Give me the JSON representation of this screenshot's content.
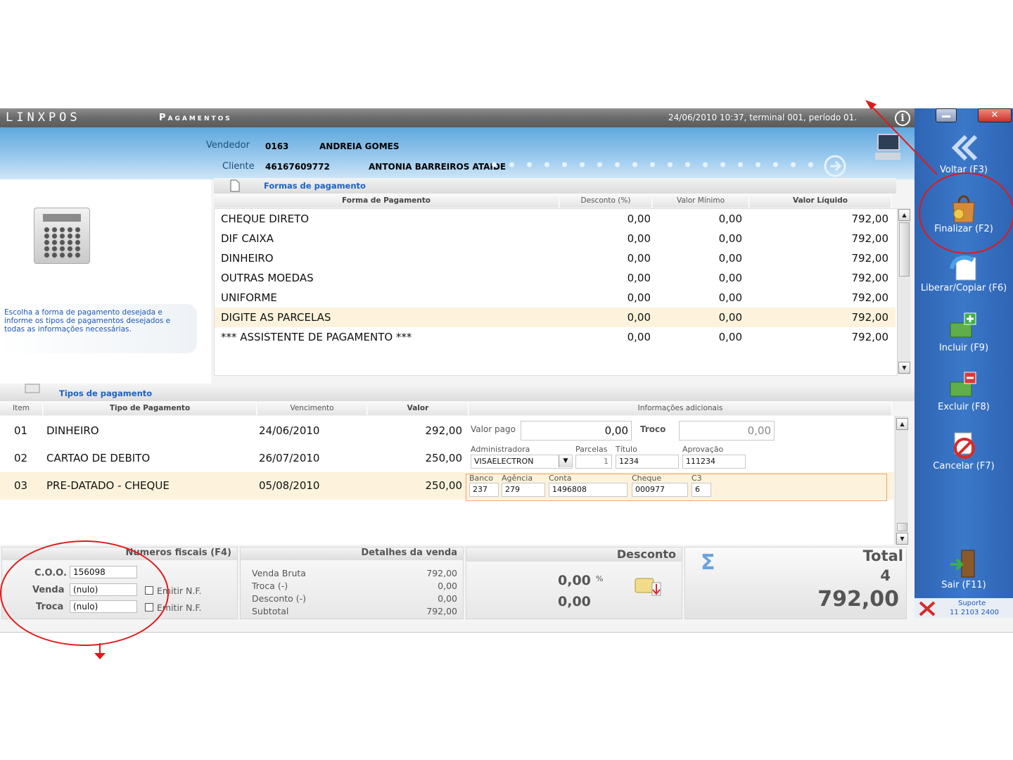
{
  "app": {
    "logo": "LINXPOS",
    "module": "Pagamentos",
    "status": "24/06/2010 10:37, terminal 001, período 01.",
    "info_icon": "i"
  },
  "header": {
    "vendedor_label": "Vendedor",
    "vendedor_code": "0163",
    "vendedor_name": "ANDREIA GOMES",
    "cliente_label": "Cliente",
    "cliente_code": "46167609772",
    "cliente_name": "ANTONIA BARREIROS ATAIDE"
  },
  "help_text": "Escolha a forma de pagamento desejada e informe os tipos de pagamentos desejados e todas as informações necessárias.",
  "formas": {
    "title": "Formas de pagamento",
    "columns": [
      "Forma de Pagamento",
      "Desconto (%)",
      "Valor Mínimo",
      "Valor Líquido"
    ],
    "rows": [
      {
        "nome": "CHEQUE DIRETO",
        "desconto": "0,00",
        "minimo": "0,00",
        "liquido": "792,00"
      },
      {
        "nome": "DIF CAIXA",
        "desconto": "0,00",
        "minimo": "0,00",
        "liquido": "792,00"
      },
      {
        "nome": "DINHEIRO",
        "desconto": "0,00",
        "minimo": "0,00",
        "liquido": "792,00"
      },
      {
        "nome": "OUTRAS MOEDAS",
        "desconto": "0,00",
        "minimo": "0,00",
        "liquido": "792,00"
      },
      {
        "nome": "UNIFORME",
        "desconto": "0,00",
        "minimo": "0,00",
        "liquido": "792,00"
      },
      {
        "nome": "DIGITE AS PARCELAS",
        "desconto": "0,00",
        "minimo": "0,00",
        "liquido": "792,00"
      },
      {
        "nome": "*** ASSISTENTE DE PAGAMENTO ***",
        "desconto": "0,00",
        "minimo": "0,00",
        "liquido": "792,00"
      }
    ]
  },
  "tipos": {
    "title": "Tipos de pagamento",
    "columns": [
      "Item",
      "Tipo de Pagamento",
      "Vencimento",
      "Valor",
      "Informações adicionais"
    ],
    "rows": [
      {
        "item": "01",
        "tipo": "DINHEIRO",
        "vencimento": "24/06/2010",
        "valor": "292,00"
      },
      {
        "item": "02",
        "tipo": "CARTAO DE DEBITO",
        "vencimento": "26/07/2010",
        "valor": "250,00"
      },
      {
        "item": "03",
        "tipo": "PRE-DATADO - CHEQUE",
        "vencimento": "05/08/2010",
        "valor": "250,00"
      }
    ],
    "info1": {
      "valor_pago_label": "Valor pago",
      "valor_pago": "0,00",
      "troco_label": "Troco",
      "troco": "0,00"
    },
    "info2": {
      "adm_label": "Administradora",
      "adm": "VISAELECTRON",
      "parcelas_label": "Parcelas",
      "parcelas": "1",
      "titulo_label": "Título",
      "titulo": "1234",
      "aprovacao_label": "Aprovação",
      "aprovacao": "111234"
    },
    "info3": {
      "banco_label": "Banco",
      "banco": "237",
      "agencia_label": "Agência",
      "agencia": "279",
      "conta_label": "Conta",
      "conta": "1496808",
      "cheque_label": "Cheque",
      "cheque": "000977",
      "c3_label": "C3",
      "c3": "6"
    }
  },
  "fiscais": {
    "title": "Numeros fiscais (F4)",
    "coo_label": "C.O.O.",
    "coo": "156098",
    "venda_label": "Venda",
    "venda": "(nulo)",
    "troca_label": "Troca",
    "troca": "(nulo)",
    "emitir_label": "Emitir N.F."
  },
  "detalhes": {
    "title": "Detalhes da venda",
    "bruta_label": "Venda Bruta",
    "bruta": "792,00",
    "troca_label": "Troca (-)",
    "troca": "0,00",
    "desconto_label": "Desconto (-)",
    "desconto": "0,00",
    "subtotal_label": "Subtotal",
    "subtotal": "792,00"
  },
  "desconto": {
    "title": "Desconto",
    "percent": "0,00",
    "percent_sign": "%",
    "valor": "0,00"
  },
  "total": {
    "title": "Total",
    "items": "4",
    "valor": "792,00",
    "sigma": "Σ"
  },
  "toolbar": {
    "voltar": "Voltar (F3)",
    "finalizar": "Finalizar (F2)",
    "liberar": "Liberar/Copiar (F6)",
    "incluir": "Incluir (F9)",
    "excluir": "Excluir (F8)",
    "cancelar": "Cancelar (F7)",
    "sair": "Sair (F11)",
    "suporte_label": "Suporte",
    "suporte_phone": "11 2103 2400"
  },
  "colors": {
    "accent_blue": "#1b62c5",
    "selected_row": "#fdf3dc",
    "annotation_red": "#e01a1a",
    "toolbar_blue": "#3b78c8"
  }
}
